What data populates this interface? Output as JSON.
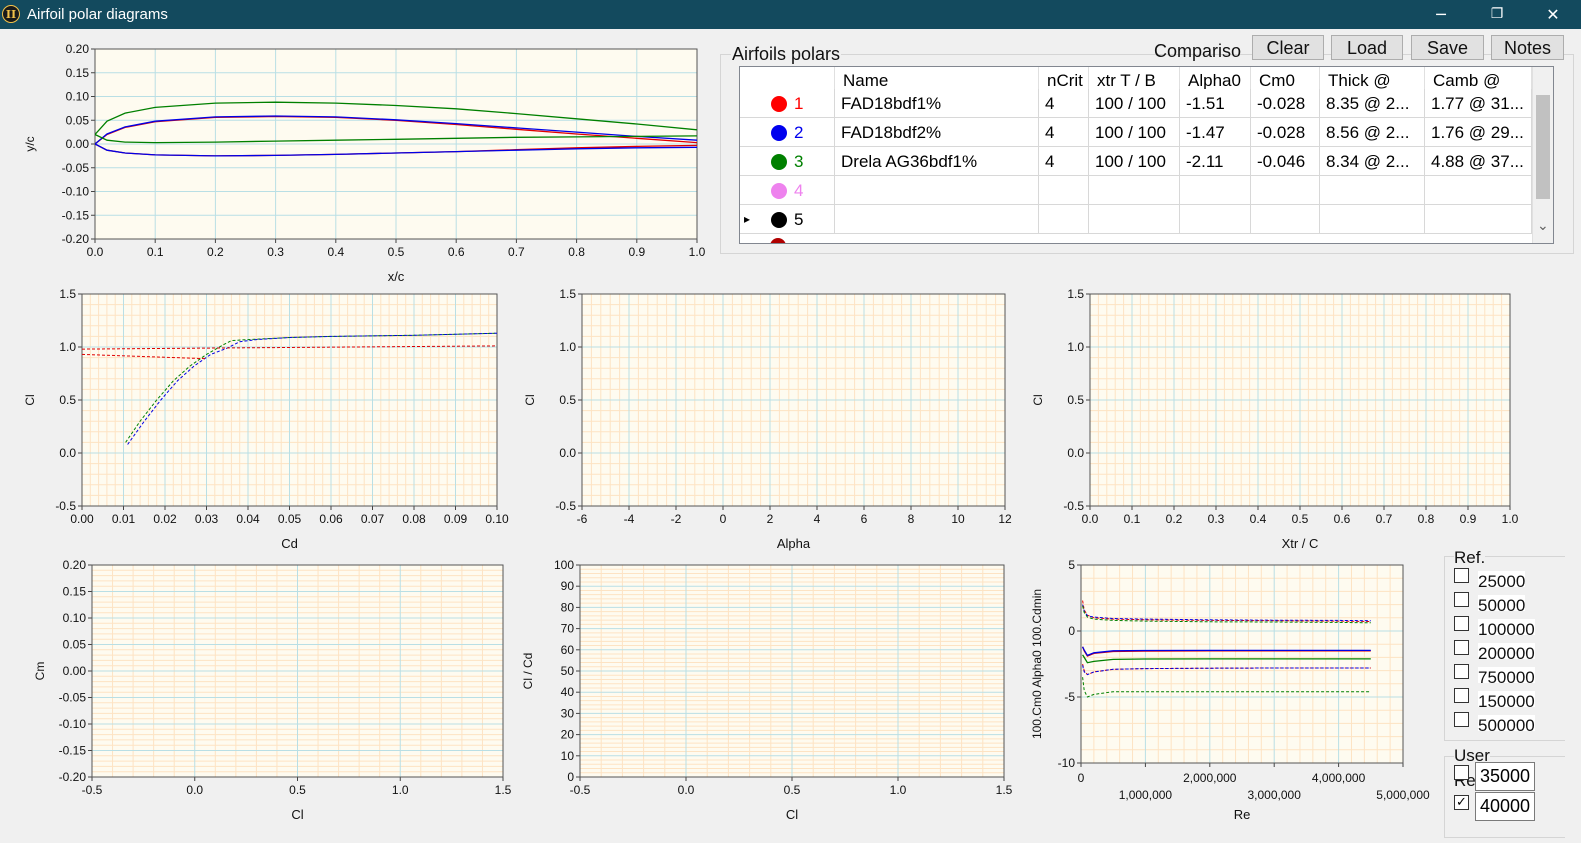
{
  "window": {
    "title": "Airfoil polar diagrams",
    "app_icon": "II",
    "minimize_icon": "─",
    "restore_icon": "❐",
    "close_icon": "✕"
  },
  "colors": {
    "titlebar": "#134a5e",
    "plot_bg": "#fefbf0",
    "minor_grid": "#fde3c3",
    "major_grid": "#b9dfe5",
    "series1": "#e00000",
    "series2": "#0000e6",
    "series3": "#008000",
    "series4": "#ee82ee",
    "series5": "#000000"
  },
  "polars": {
    "title": "Airfoils polars",
    "compare_label": "Compariso",
    "buttons": {
      "clear": "Clear",
      "load": "Load",
      "save": "Save",
      "notes": "Notes"
    },
    "columns": [
      "Name",
      "nCrit",
      "xtr T / B",
      "Alpha0",
      "Cm0",
      "Thick @",
      "Camb @"
    ],
    "rows": [
      {
        "index": "1",
        "color": "#ff0000",
        "name": "FAD18bdf1%",
        "ncrit": "4",
        "xtr": "100 / 100",
        "alpha0": "-1.51",
        "cm0": "-0.028",
        "thick": "8.35 @ 2...",
        "camb": "1.77 @ 31..."
      },
      {
        "index": "2",
        "color": "#0000ee",
        "name": "FAD18bdf2%",
        "ncrit": "4",
        "xtr": "100 / 100",
        "alpha0": "-1.47",
        "cm0": "-0.028",
        "thick": "8.56 @ 2...",
        "camb": "1.76 @ 29..."
      },
      {
        "index": "3",
        "color": "#008000",
        "name": "Drela AG36bdf1%",
        "ncrit": "4",
        "xtr": "100 / 100",
        "alpha0": "-2.11",
        "cm0": "-0.046",
        "thick": "8.34 @ 2...",
        "camb": "4.88 @ 37..."
      },
      {
        "index": "4",
        "color": "#ee82ee",
        "name": "",
        "ncrit": "",
        "xtr": "",
        "alpha0": "",
        "cm0": "",
        "thick": "",
        "camb": ""
      },
      {
        "index": "5",
        "color": "#000000",
        "name": "",
        "ncrit": "",
        "xtr": "",
        "alpha0": "",
        "cm0": "",
        "thick": "",
        "camb": ""
      }
    ],
    "row_pointer_icon": "▸",
    "scroll_down_icon": "⌄"
  },
  "ref_re": {
    "title": "Ref.",
    "values": [
      "25000",
      "50000",
      "100000",
      "200000",
      "750000",
      "150000",
      "500000"
    ]
  },
  "user_re": {
    "title": "User",
    "label": "Re",
    "values": [
      {
        "value": "35000",
        "checked": false
      },
      {
        "value": "40000",
        "checked": true
      }
    ],
    "check_mark": "✓"
  },
  "chart_data": [
    {
      "type": "line",
      "id": "shape",
      "xlabel": "x/c",
      "ylabel": "y/c",
      "xlim": [
        0,
        1
      ],
      "ylim": [
        -0.2,
        0.2
      ],
      "xticks": [
        0,
        0.1,
        0.2,
        0.3,
        0.4,
        0.5,
        0.6,
        0.7,
        0.8,
        0.9,
        1
      ],
      "xtick_labels": [
        "0.0",
        "0.1",
        "0.2",
        "0.3",
        "0.4",
        "0.5",
        "0.6",
        "0.7",
        "0.8",
        "0.9",
        "1.0"
      ],
      "yticks": [
        -0.2,
        -0.15,
        -0.1,
        -0.05,
        0,
        0.05,
        0.1,
        0.15,
        0.2
      ],
      "ytick_labels": [
        "-0.20",
        "-0.15",
        "-0.10",
        "-0.05",
        "0.00",
        "0.05",
        "0.10",
        "0.15",
        "0.20"
      ],
      "grid": "major",
      "series": [
        {
          "color": "#e00000",
          "x": [
            0,
            0.02,
            0.05,
            0.1,
            0.2,
            0.3,
            0.4,
            0.5,
            0.6,
            0.7,
            0.8,
            0.9,
            1.0
          ],
          "y": [
            0,
            0.02,
            0.035,
            0.047,
            0.056,
            0.058,
            0.056,
            0.05,
            0.041,
            0.031,
            0.021,
            0.012,
            0.003
          ]
        },
        {
          "color": "#e00000",
          "x": [
            0,
            0.02,
            0.05,
            0.1,
            0.2,
            0.3,
            0.4,
            0.5,
            0.6,
            0.7,
            0.8,
            0.9,
            1.0
          ],
          "y": [
            0,
            -0.013,
            -0.019,
            -0.023,
            -0.025,
            -0.024,
            -0.022,
            -0.019,
            -0.016,
            -0.012,
            -0.008,
            -0.005,
            -0.003
          ]
        },
        {
          "color": "#0000e6",
          "x": [
            0,
            0.02,
            0.05,
            0.1,
            0.2,
            0.3,
            0.4,
            0.5,
            0.6,
            0.7,
            0.8,
            0.9,
            1.0
          ],
          "y": [
            0,
            0.021,
            0.036,
            0.048,
            0.057,
            0.059,
            0.057,
            0.051,
            0.043,
            0.034,
            0.025,
            0.016,
            0.008
          ]
        },
        {
          "color": "#0000e6",
          "x": [
            0,
            0.02,
            0.05,
            0.1,
            0.2,
            0.3,
            0.4,
            0.5,
            0.6,
            0.7,
            0.8,
            0.9,
            1.0
          ],
          "y": [
            0,
            -0.013,
            -0.019,
            -0.023,
            -0.025,
            -0.024,
            -0.022,
            -0.019,
            -0.016,
            -0.013,
            -0.01,
            -0.008,
            -0.007
          ]
        },
        {
          "color": "#008000",
          "x": [
            0,
            0.02,
            0.05,
            0.1,
            0.2,
            0.3,
            0.4,
            0.5,
            0.6,
            0.7,
            0.8,
            0.9,
            1.0
          ],
          "y": [
            0.02,
            0.048,
            0.065,
            0.077,
            0.086,
            0.088,
            0.086,
            0.081,
            0.074,
            0.064,
            0.053,
            0.042,
            0.03
          ]
        },
        {
          "color": "#008000",
          "x": [
            0,
            0.02,
            0.05,
            0.1,
            0.2,
            0.3,
            0.4,
            0.5,
            0.6,
            0.7,
            0.8,
            0.9,
            1.0
          ],
          "y": [
            0.02,
            0.008,
            0.004,
            0.003,
            0.004,
            0.006,
            0.008,
            0.01,
            0.012,
            0.014,
            0.015,
            0.016,
            0.017
          ]
        }
      ]
    },
    {
      "type": "line",
      "id": "cl-cd",
      "xlabel": "Cd",
      "ylabel": "Cl",
      "xlim": [
        0,
        0.1
      ],
      "ylim": [
        -0.5,
        1.5
      ],
      "xticks": [
        0,
        0.01,
        0.02,
        0.03,
        0.04,
        0.05,
        0.06,
        0.07,
        0.08,
        0.09,
        0.1
      ],
      "xtick_labels": [
        "0.00",
        "0.01",
        "0.02",
        "0.03",
        "0.04",
        "0.05",
        "0.06",
        "0.07",
        "0.08",
        "0.09",
        "0.10"
      ],
      "yticks": [
        -0.5,
        0,
        0.5,
        1,
        1.5
      ],
      "ytick_labels": [
        "-0.5",
        "0.0",
        "0.5",
        "1.0",
        "1.5"
      ],
      "grid": "minor",
      "series": [
        {
          "color": "#008000",
          "dashed": true,
          "x": [
            0.0105,
            0.014,
            0.018,
            0.022,
            0.026,
            0.03,
            0.034,
            0.036,
            0.04,
            0.05,
            0.06,
            0.08,
            0.1
          ],
          "y": [
            0.1,
            0.3,
            0.5,
            0.68,
            0.82,
            0.93,
            1.02,
            1.06,
            1.07,
            1.09,
            1.1,
            1.11,
            1.13
          ]
        },
        {
          "color": "#0000e6",
          "dashed": true,
          "x": [
            0.011,
            0.015,
            0.019,
            0.023,
            0.027,
            0.031,
            0.035,
            0.038,
            0.042,
            0.05,
            0.06,
            0.08,
            0.1
          ],
          "y": [
            0.08,
            0.3,
            0.5,
            0.68,
            0.82,
            0.93,
            0.99,
            1.05,
            1.07,
            1.09,
            1.1,
            1.11,
            1.13
          ]
        },
        {
          "color": "#e00000",
          "dashed": true,
          "x": [
            0,
            0.03,
            0.1
          ],
          "y": [
            0.98,
            0.99,
            1.01
          ]
        },
        {
          "color": "#e00000",
          "dashed": true,
          "x": [
            0,
            0.03
          ],
          "y": [
            0.93,
            0.89
          ]
        }
      ]
    },
    {
      "type": "line",
      "id": "cl-alpha",
      "xlabel": "Alpha",
      "ylabel": "Cl",
      "xlim": [
        -6,
        12
      ],
      "ylim": [
        -0.5,
        1.5
      ],
      "xticks": [
        -6,
        -4,
        -2,
        0,
        2,
        4,
        6,
        8,
        10,
        12
      ],
      "xtick_labels": [
        "-6",
        "-4",
        "-2",
        "0",
        "2",
        "4",
        "6",
        "8",
        "10",
        "12"
      ],
      "yticks": [
        -0.5,
        0,
        0.5,
        1,
        1.5
      ],
      "ytick_labels": [
        "-0.5",
        "0.0",
        "0.5",
        "1.0",
        "1.5"
      ],
      "grid": "minor",
      "series": []
    },
    {
      "type": "line",
      "id": "cl-xtr",
      "xlabel": "Xtr / C",
      "ylabel": "Cl",
      "xlim": [
        0,
        1
      ],
      "ylim": [
        -0.5,
        1.5
      ],
      "xticks": [
        0,
        0.1,
        0.2,
        0.3,
        0.4,
        0.5,
        0.6,
        0.7,
        0.8,
        0.9,
        1
      ],
      "xtick_labels": [
        "0.0",
        "0.1",
        "0.2",
        "0.3",
        "0.4",
        "0.5",
        "0.6",
        "0.7",
        "0.8",
        "0.9",
        "1.0"
      ],
      "yticks": [
        -0.5,
        0,
        0.5,
        1,
        1.5
      ],
      "ytick_labels": [
        "-0.5",
        "0.0",
        "0.5",
        "1.0",
        "1.5"
      ],
      "grid": "minor",
      "series": []
    },
    {
      "type": "line",
      "id": "cm-cl",
      "xlabel": "Cl",
      "ylabel": "Cm",
      "xlim": [
        -0.5,
        1.5
      ],
      "ylim": [
        -0.2,
        0.2
      ],
      "xticks": [
        -0.5,
        0,
        0.5,
        1,
        1.5
      ],
      "xtick_labels": [
        "-0.5",
        "0.0",
        "0.5",
        "1.0",
        "1.5"
      ],
      "yticks": [
        -0.2,
        -0.15,
        -0.1,
        -0.05,
        0,
        0.05,
        0.1,
        0.15,
        0.2
      ],
      "ytick_labels": [
        "-0.20",
        "-0.15",
        "-0.10",
        "-0.05",
        "0.00",
        "0.05",
        "0.10",
        "0.15",
        "0.20"
      ],
      "grid": "minor",
      "series": []
    },
    {
      "type": "line",
      "id": "clcd-cl",
      "xlabel": "Cl",
      "ylabel": "Cl / Cd",
      "xlim": [
        -0.5,
        1.5
      ],
      "ylim": [
        0,
        100
      ],
      "xticks": [
        -0.5,
        0,
        0.5,
        1,
        1.5
      ],
      "xtick_labels": [
        "-0.5",
        "0.0",
        "0.5",
        "1.0",
        "1.5"
      ],
      "yticks": [
        0,
        10,
        20,
        30,
        40,
        50,
        60,
        70,
        80,
        90,
        100
      ],
      "ytick_labels": [
        "0",
        "10",
        "20",
        "30",
        "40",
        "50",
        "60",
        "70",
        "80",
        "90",
        "100"
      ],
      "grid": "minor",
      "series": []
    },
    {
      "type": "line",
      "id": "re-plot",
      "xlabel": "Re",
      "ylabel": "100.Cm0  Alpha0  100.Cdmin",
      "xlim": [
        0,
        5000000
      ],
      "ylim": [
        -10,
        5
      ],
      "xticks": [
        0,
        1000000,
        2000000,
        3000000,
        4000000,
        5000000
      ],
      "xtick_labels": [
        "0",
        "1,000,000",
        "2,000,000",
        "3,000,000",
        "4,000,000",
        "5,000,000"
      ],
      "yticks": [
        -10,
        -5,
        0,
        5
      ],
      "ytick_labels": [
        "-10",
        "-5",
        "0",
        "5"
      ],
      "grid": "minor",
      "series": [
        {
          "color": "#e00000",
          "dashed": true,
          "x": [
            25000,
            50000,
            100000,
            200000,
            500000,
            1000000,
            2000000,
            3000000,
            4000000,
            4500000
          ],
          "y": [
            2.3,
            1.6,
            1.2,
            1.0,
            0.9,
            0.85,
            0.8,
            0.78,
            0.75,
            0.72
          ]
        },
        {
          "color": "#0000e6",
          "dashed": true,
          "x": [
            25000,
            50000,
            100000,
            200000,
            500000,
            1000000,
            2000000,
            3000000,
            4000000,
            4500000
          ],
          "y": [
            2.0,
            1.5,
            1.15,
            1.05,
            0.95,
            0.9,
            0.85,
            0.82,
            0.8,
            0.78
          ]
        },
        {
          "color": "#008000",
          "dashed": true,
          "x": [
            25000,
            50000,
            100000,
            200000,
            500000,
            1000000,
            2000000,
            3000000,
            4000000,
            4500000
          ],
          "y": [
            1.9,
            1.4,
            1.05,
            0.9,
            0.8,
            0.75,
            0.7,
            0.68,
            0.65,
            0.62
          ]
        },
        {
          "color": "#e00000",
          "x": [
            25000,
            50000,
            100000,
            200000,
            500000,
            1000000,
            2000000,
            3000000,
            4000000,
            4500000
          ],
          "y": [
            -1.2,
            -1.5,
            -1.9,
            -1.7,
            -1.55,
            -1.52,
            -1.51,
            -1.51,
            -1.51,
            -1.51
          ]
        },
        {
          "color": "#0000e6",
          "x": [
            25000,
            50000,
            100000,
            200000,
            500000,
            1000000,
            2000000,
            3000000,
            4000000,
            4500000
          ],
          "y": [
            -1.2,
            -1.45,
            -1.85,
            -1.65,
            -1.5,
            -1.48,
            -1.47,
            -1.47,
            -1.47,
            -1.47
          ]
        },
        {
          "color": "#008000",
          "x": [
            25000,
            50000,
            100000,
            200000,
            500000,
            1000000,
            2000000,
            3000000,
            4000000,
            4500000
          ],
          "y": [
            -1.8,
            -2.0,
            -2.4,
            -2.3,
            -2.15,
            -2.12,
            -2.11,
            -2.11,
            -2.11,
            -2.11
          ]
        },
        {
          "color": "#e00000",
          "dashed": true,
          "x": [
            25000,
            50000,
            100000,
            200000,
            500000,
            1000000,
            2000000,
            3000000,
            4000000,
            4500000
          ],
          "y": [
            -2.5,
            -3.0,
            -3.3,
            -3.1,
            -2.9,
            -2.85,
            -2.82,
            -2.8,
            -2.8,
            -2.8
          ]
        },
        {
          "color": "#0000e6",
          "dashed": true,
          "x": [
            25000,
            50000,
            100000,
            200000,
            500000,
            1000000,
            2000000,
            3000000,
            4000000,
            4500000
          ],
          "y": [
            -2.6,
            -3.1,
            -3.3,
            -3.1,
            -2.9,
            -2.85,
            -2.82,
            -2.8,
            -2.8,
            -2.8
          ]
        },
        {
          "color": "#008000",
          "dashed": true,
          "x": [
            25000,
            50000,
            100000,
            200000,
            500000,
            1000000,
            2000000,
            3000000,
            4000000,
            4500000
          ],
          "y": [
            -3.5,
            -4.5,
            -5.0,
            -4.8,
            -4.6,
            -4.6,
            -4.6,
            -4.6,
            -4.6,
            -4.6
          ]
        }
      ]
    }
  ]
}
